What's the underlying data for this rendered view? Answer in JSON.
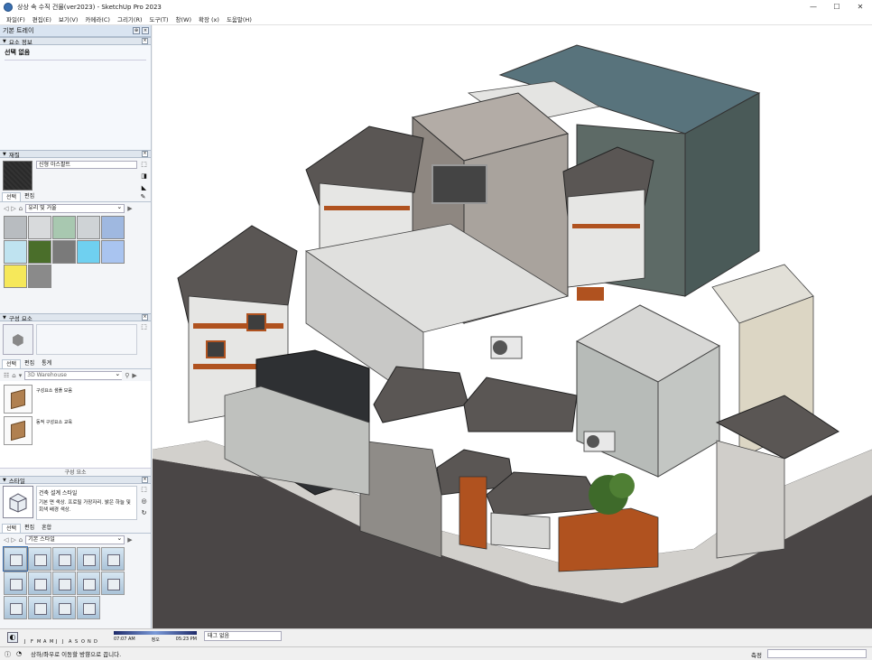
{
  "window": {
    "title": "상상 속 수직 건물(ver2023) - SketchUp Pro 2023",
    "minimize": "—",
    "maximize": "☐",
    "close": "✕"
  },
  "menu": [
    "파일(F)",
    "편집(E)",
    "보기(V)",
    "카메라(C)",
    "그리기(R)",
    "도구(T)",
    "창(W)",
    "확장 (x)",
    "도움말(H)"
  ],
  "tray": {
    "title": "기본 트레이",
    "entity_info": {
      "header": "요소 정보",
      "selection": "선택 없음"
    },
    "materials": {
      "header": "재질",
      "name": "신형 아스팔트",
      "tabs": [
        "선택",
        "편집"
      ],
      "collection": "유리 및 거울",
      "swatches": [
        "#b8bcc0",
        "#d8dadc",
        "#a8c8b0",
        "#cfd3d6",
        "#9fb8e0",
        "#bfe3f0",
        "#4a6e2a",
        "#7a7a7a",
        "#6fd0f0",
        "#a9c4f0",
        "#f6e85a",
        "#8a8a8a"
      ]
    },
    "components": {
      "header": "구성 요소",
      "tabs": [
        "선택",
        "편집",
        "통계"
      ],
      "search_placeholder": "3D Warehouse",
      "items": [
        {
          "label": "구성요소 샘플 모음"
        },
        {
          "label": "동적 구성요소 교육"
        }
      ],
      "footer": "구성 요소"
    },
    "styles": {
      "header": "스타일",
      "name": "건축 설계 스타일",
      "description": "기본 면 색상. 프로필 가장자리. 밝은 하늘 및 회색 배경 색상.",
      "tabs": [
        "선택",
        "편집",
        "혼합"
      ],
      "collection": "기본 스타일",
      "cell_count": 14
    }
  },
  "shadow": {
    "months": [
      "J",
      "F",
      "M",
      "A",
      "M",
      "J",
      "J",
      "A",
      "S",
      "O",
      "N",
      "D"
    ],
    "time_start": "07:07 AM",
    "time_mid": "정오",
    "time_end": "05:23 PM"
  },
  "scene": {
    "value": "태그 없음"
  },
  "status": {
    "text": "상하/좌우로 이동할 방향으로 끕니다.",
    "measure_label": "측정"
  },
  "colors": {
    "accent": "#3a6fb0",
    "roof_dark": "#5a5654",
    "timber_brown": "#b0521f",
    "facade_grey": "#a9a39d",
    "roof_teal": "#58737c"
  }
}
